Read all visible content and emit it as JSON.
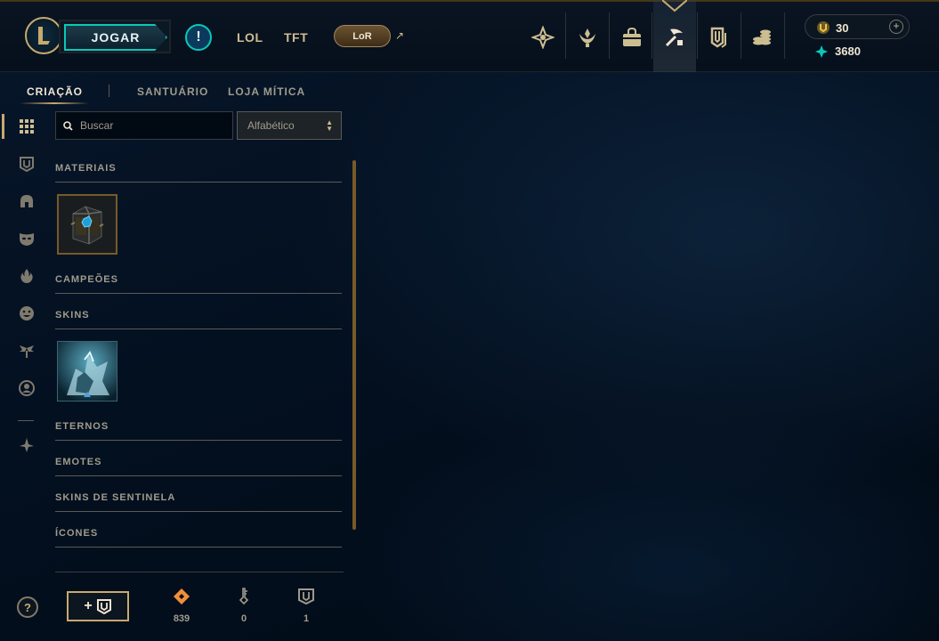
{
  "topbar": {
    "play_label": "JOGAR",
    "alert_glyph": "!",
    "nav_links": [
      "LOL",
      "TFT"
    ],
    "lor_label": "LoR",
    "icons": [
      "tft-icon",
      "honor-icon",
      "store-icon",
      "loot-icon",
      "collection-icon",
      "currency-stack-icon"
    ],
    "active_icon": "loot-icon"
  },
  "currency": {
    "rp": "30",
    "blue_essence": "3680"
  },
  "subnav": {
    "tabs": [
      "CRIAÇÃO",
      "SANTUÁRIO",
      "LOJA MÍTICA"
    ],
    "active": "CRIAÇÃO"
  },
  "sidebar": {
    "icons": [
      "all-grid-icon",
      "chest-icon",
      "helmet-icon",
      "mask-icon",
      "ward-icon",
      "emote-icon",
      "wings-icon",
      "profile-icon",
      "compass-icon"
    ],
    "help": "?"
  },
  "search": {
    "placeholder": "Buscar"
  },
  "sort": {
    "selected": "Alfabético"
  },
  "categories": {
    "materiais": "MATERIAIS",
    "campeoes": "CAMPEÕES",
    "skins": "SKINS",
    "eternos": "ETERNOS",
    "emotes": "EMOTES",
    "sentinela": "SKINS DE SENTINELA",
    "icones": "ÍCONES"
  },
  "footer": {
    "craft_button": "+",
    "resources": [
      {
        "icon": "orange-essence-icon",
        "count": "839"
      },
      {
        "icon": "key-icon",
        "count": "0"
      },
      {
        "icon": "chest-icon",
        "count": "1"
      }
    ]
  },
  "colors": {
    "gold": "#c8aa6e",
    "teal": "#0ac8b9",
    "orange_essence": "#f08f3a",
    "background": "#010a13"
  }
}
